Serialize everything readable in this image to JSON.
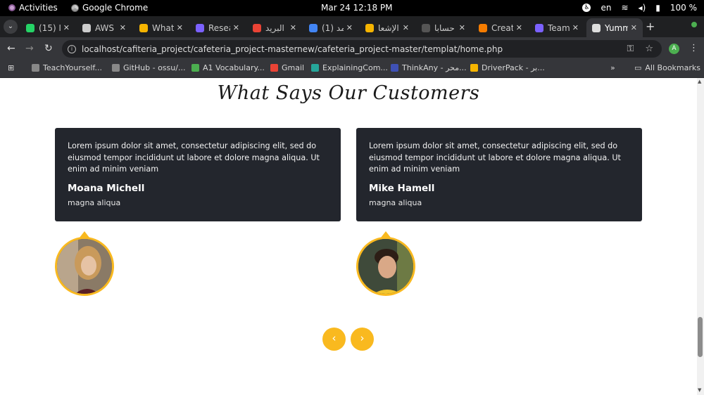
{
  "system_bar": {
    "activities": "Activities",
    "app_name": "Google Chrome",
    "datetime": "Mar 24  12:18 PM",
    "language": "en",
    "battery": "100 %"
  },
  "tabs": [
    {
      "title": "(15) وا",
      "color": "#25d366"
    },
    {
      "title": "AWS",
      "color": "#cccccc"
    },
    {
      "title": "What",
      "color": "#f5b400"
    },
    {
      "title": "Resea",
      "color": "#7b61ff"
    },
    {
      "title": "البريد",
      "color": "#ea4335"
    },
    {
      "title": "(1) مد",
      "color": "#4285f4"
    },
    {
      "title": "الإشعا",
      "color": "#f5b400"
    },
    {
      "title": "حسابا",
      "color": "#555555"
    },
    {
      "title": "Creat",
      "color": "#f57c00"
    },
    {
      "title": "Team",
      "color": "#7b61ff"
    },
    {
      "title": "Yumm",
      "color": "#dddddd"
    }
  ],
  "address_bar": {
    "url": "localhost/cafiteria_project/cafeteria_project-masternew/cafeteria_project-master/templat/home.php",
    "profile_initial": "A"
  },
  "bookmarks": [
    {
      "label": "TeachYourself...",
      "color": "#888888"
    },
    {
      "label": "GitHub - ossu/...",
      "color": "#888888"
    },
    {
      "label": "A1 Vocabulary...",
      "color": "#4caf50"
    },
    {
      "label": "Gmail",
      "color": "#ea4335"
    },
    {
      "label": "ExplainingCom...",
      "color": "#26a69a"
    },
    {
      "label": "ThinkAny - محر...",
      "color": "#3f51b5"
    },
    {
      "label": "DriverPack - بر...",
      "color": "#f5b400"
    }
  ],
  "bookmarks_overflow": "»",
  "all_bookmarks": "All Bookmarks",
  "section": {
    "heading": "What Says Our Customers"
  },
  "testimonials": [
    {
      "quote": "Lorem ipsum dolor sit amet, consectetur adipiscing elit, sed do eiusmod tempor incididunt ut labore et dolore magna aliqua. Ut enim ad minim veniam",
      "name": "Moana Michell",
      "role": "magna aliqua"
    },
    {
      "quote": "Lorem ipsum dolor sit amet, consectetur adipiscing elit, sed do eiusmod tempor incididunt ut labore et dolore magna aliqua. Ut enim ad minim veniam",
      "name": "Mike Hamell",
      "role": "magna aliqua"
    }
  ],
  "carousel": {
    "prev": "‹",
    "next": "›"
  },
  "colors": {
    "accent": "#f9b91f",
    "card": "#23262d"
  }
}
